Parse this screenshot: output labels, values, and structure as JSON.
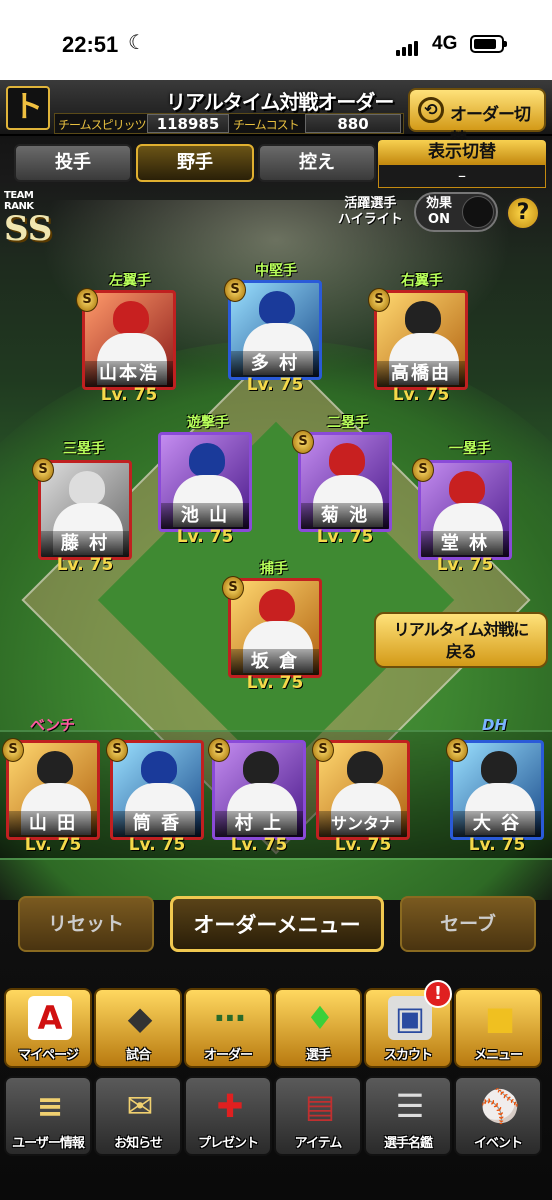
{
  "status_bar": {
    "time": "22:51",
    "network": "4G"
  },
  "header": {
    "logo": "ト",
    "title": "リアルタイム対戦オーダー",
    "team_spirits_label": "チームスピリッツ",
    "team_spirits_value": "118985",
    "team_cost_label": "チームコスト",
    "team_cost_value": "880",
    "order_switch_label": "オーダー切替"
  },
  "tabs": [
    {
      "label": "投手",
      "active": false
    },
    {
      "label": "野手",
      "active": true
    },
    {
      "label": "控え",
      "active": false
    }
  ],
  "display_switch": {
    "label": "表示切替",
    "value": "–"
  },
  "team_rank": {
    "label": "TEAM RANK",
    "value": "SS"
  },
  "highlight": {
    "label_line1": "活躍選手",
    "label_line2": "ハイライト",
    "effect_line1": "効果",
    "effect_line2": "ON"
  },
  "help_icon": "?",
  "fielders": [
    {
      "position": "左翼手",
      "name": "山本浩",
      "level": "Lv. 75",
      "badge": "S"
    },
    {
      "position": "中堅手",
      "name": "多 村",
      "level": "Lv. 75",
      "badge": "S"
    },
    {
      "position": "右翼手",
      "name": "高橋由",
      "level": "Lv. 75",
      "badge": "S"
    },
    {
      "position": "三塁手",
      "name": "藤 村",
      "level": "Lv. 75",
      "badge": "S"
    },
    {
      "position": "遊撃手",
      "name": "池 山",
      "level": "Lv. 75",
      "badge": "S"
    },
    {
      "position": "二塁手",
      "name": "菊 池",
      "level": "Lv. 75",
      "badge": "S"
    },
    {
      "position": "一塁手",
      "name": "堂 林",
      "level": "Lv. 75",
      "badge": "S"
    },
    {
      "position": "捕手",
      "name": "坂 倉",
      "level": "Lv. 75",
      "badge": "S"
    }
  ],
  "back_button": {
    "line1": "リアルタイム対戦に",
    "line2": "戻る"
  },
  "bench_label": "ベンチ",
  "dh_label": "DH",
  "bench": [
    {
      "name": "山 田",
      "level": "Lv. 75",
      "badge": "S"
    },
    {
      "name": "筒 香",
      "level": "Lv. 75",
      "badge": "S"
    },
    {
      "name": "村 上",
      "level": "Lv. 75",
      "badge": "S"
    },
    {
      "name": "サンタナ",
      "level": "Lv. 75",
      "badge": "S"
    }
  ],
  "dh": {
    "name": "大 谷",
    "level": "Lv. 75",
    "badge": "S"
  },
  "actions": {
    "reset": "リセット",
    "order_menu": "オーダーメニュー",
    "save": "セーブ"
  },
  "nav_row1": [
    {
      "label": "マイページ",
      "icon": "A"
    },
    {
      "label": "試合",
      "icon": "◆"
    },
    {
      "label": "オーダー",
      "icon": "⋯"
    },
    {
      "label": "選手",
      "icon": "♦"
    },
    {
      "label": "スカウト",
      "icon": "▣"
    },
    {
      "label": "メニュー",
      "icon": "■"
    }
  ],
  "scout_notification": "!",
  "nav_row2": [
    {
      "label": "ユーザー情報",
      "icon": "≡"
    },
    {
      "label": "お知らせ",
      "icon": "✉"
    },
    {
      "label": "プレゼント",
      "icon": "✚"
    },
    {
      "label": "アイテム",
      "icon": "▤"
    },
    {
      "label": "選手名鑑",
      "icon": "☰"
    },
    {
      "label": "イベント",
      "icon": "⚾"
    }
  ]
}
